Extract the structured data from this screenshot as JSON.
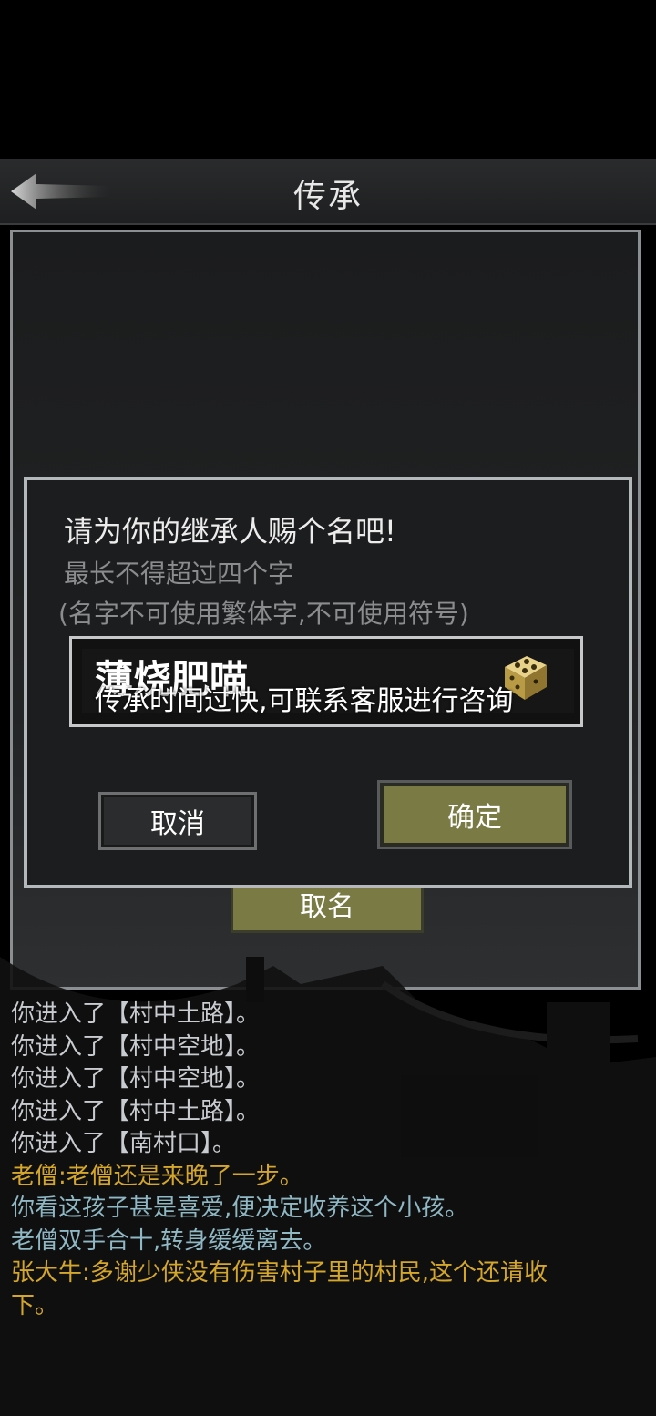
{
  "header": {
    "title": "传承"
  },
  "background_button": {
    "label": "取名"
  },
  "dialog": {
    "prompt": "请为你的继承人赐个名吧!",
    "hint_line1": "最长不得超过四个字",
    "hint_line2": "(名字不可使用繁体字,不可使用符号)",
    "name_value": "薄烧肥喵",
    "toast": "传承时间过快,可联系客服进行咨询",
    "cancel_label": "取消",
    "confirm_label": "确定"
  },
  "log": [
    {
      "text": "你进入了【村中土路】。",
      "color": "#c8cbcf"
    },
    {
      "text": "你进入了【村中空地】。",
      "color": "#c8cbcf"
    },
    {
      "text": "你进入了【村中空地】。",
      "color": "#c8cbcf"
    },
    {
      "text": "你进入了【村中土路】。",
      "color": "#c8cbcf"
    },
    {
      "text": "你进入了【南村口】。",
      "color": "#c8cbcf"
    },
    {
      "text": "老僧:老僧还是来晚了一步。",
      "color": "#d4a62a"
    },
    {
      "text": "你看这孩子甚是喜爱,便决定收养这个小孩。",
      "color": "#8fb7c4"
    },
    {
      "text": "老僧双手合十,转身缓缓离去。",
      "color": "#8fb7c4"
    },
    {
      "text": "张大牛:多谢少侠没有伤害村子里的村民,这个还请收",
      "color": "#d4a62a"
    },
    {
      "text": "下。",
      "color": "#d4a62a"
    }
  ],
  "colors": {
    "accent_button": "#7a7a45",
    "dialog_border": "#b5b8bb"
  }
}
